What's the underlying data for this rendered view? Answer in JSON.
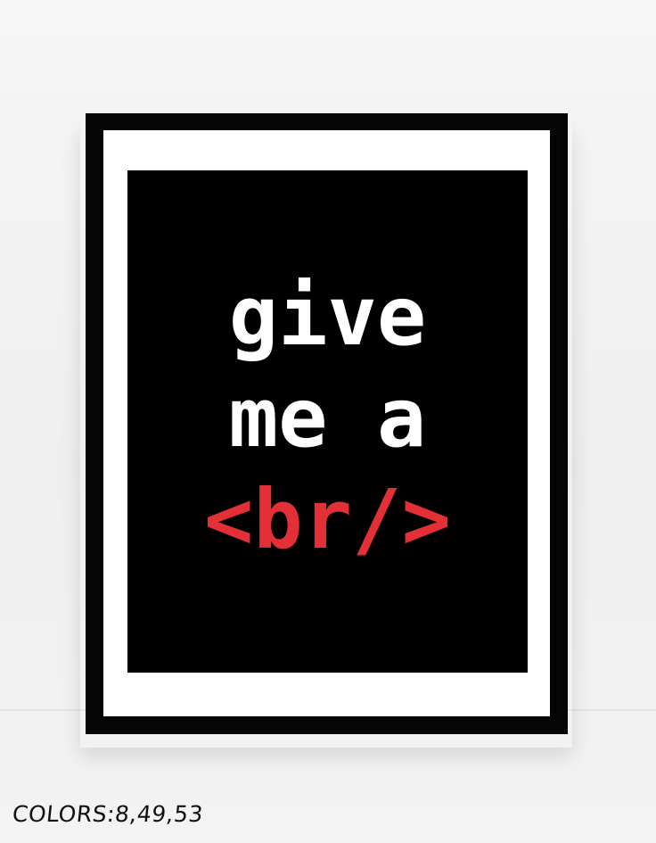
{
  "poster": {
    "line1": "give",
    "line2": "me a",
    "line3": "<br/>",
    "text_color": "#ffffff",
    "accent_color": "#e23036",
    "background_color": "#000000",
    "frame_color": "#050505",
    "mat_color": "#ffffff"
  },
  "caption": {
    "colors": "COLORS:8,49,53"
  }
}
